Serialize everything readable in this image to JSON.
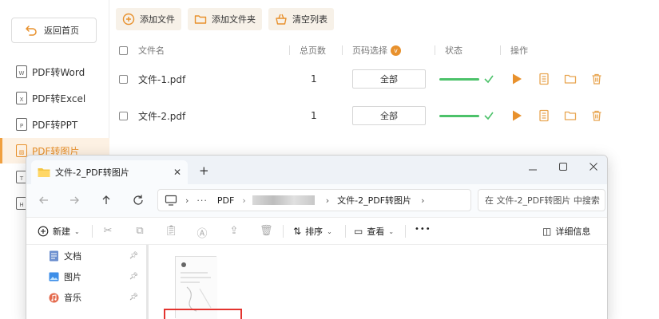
{
  "sidebar": {
    "back_label": "返回首页",
    "items": [
      {
        "label": "PDF转Word",
        "icon_text": "W"
      },
      {
        "label": "PDF转Excel",
        "icon_text": "X"
      },
      {
        "label": "PDF转PPT",
        "icon_text": "P"
      },
      {
        "label": "PDF转图片",
        "icon_text": "▨"
      },
      {
        "label": "",
        "icon_text": "T"
      },
      {
        "label": "",
        "icon_text": "H"
      }
    ]
  },
  "toolbar": {
    "add_file": "添加文件",
    "add_folder": "添加文件夹",
    "clear_list": "清空列表"
  },
  "table": {
    "headers": {
      "filename": "文件名",
      "total_pages": "总页数",
      "page_select": "页码选择",
      "page_select_badge": "v",
      "status": "状态",
      "actions": "操作"
    },
    "rows": [
      {
        "name": "文件-1.pdf",
        "pages": "1",
        "select": "全部"
      },
      {
        "name": "文件-2.pdf",
        "pages": "1",
        "select": "全部"
      }
    ]
  },
  "explorer": {
    "tab_title": "文件-2_PDF转图片",
    "tab_close": "✕",
    "new_tab": "+",
    "address": {
      "seg1": "PDF",
      "seg_last": "文件-2_PDF转图片"
    },
    "search_placeholder": "在 文件-2_PDF转图片 中搜索",
    "commands": {
      "new": "新建",
      "sort": "排序",
      "view": "查看",
      "more": "•••",
      "details": "详细信息"
    },
    "nav_pane": [
      {
        "label": "文档",
        "icon": "document-icon"
      },
      {
        "label": "图片",
        "icon": "picture-icon"
      },
      {
        "label": "音乐",
        "icon": "music-icon"
      }
    ]
  },
  "colors": {
    "accent": "#e8912d",
    "status_green": "#4cc26a",
    "selection_red": "#e3342f"
  }
}
